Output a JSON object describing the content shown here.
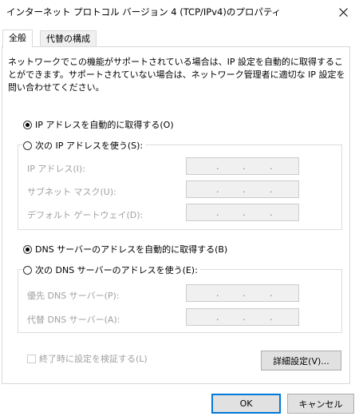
{
  "window": {
    "title": "インターネット プロトコル バージョン 4 (TCP/IPv4)のプロパティ"
  },
  "tabs": [
    {
      "label": "全般",
      "active": true
    },
    {
      "label": "代替の構成",
      "active": false
    }
  ],
  "general": {
    "description": "ネットワークでこの機能がサポートされている場合は、IP 設定を自動的に取得することができます。サポートされていない場合は、ネットワーク管理者に適切な IP 設定を問い合わせてください。",
    "ip_auto_label": "IP アドレスを自動的に取得する(O)",
    "ip_auto_selected": true,
    "ip_manual_label": "次の IP アドレスを使う(S):",
    "ip_manual_selected": false,
    "ip_address_label": "IP アドレス(I):",
    "subnet_label": "サブネット マスク(U):",
    "gateway_label": "デフォルト ゲートウェイ(D):",
    "dns_auto_label": "DNS サーバーのアドレスを自動的に取得する(B)",
    "dns_auto_selected": true,
    "dns_manual_label": "次の DNS サーバーのアドレスを使う(E):",
    "dns_manual_selected": false,
    "preferred_dns_label": "優先 DNS サーバー(P):",
    "alternate_dns_label": "代替 DNS サーバー(A):",
    "validate_label": "終了時に設定を検証する(L)",
    "validate_checked": false,
    "advanced_label": "詳細設定(V)..."
  },
  "ip_separator": ".",
  "buttons": {
    "ok_label": "OK",
    "cancel_label": "キャンセル"
  }
}
